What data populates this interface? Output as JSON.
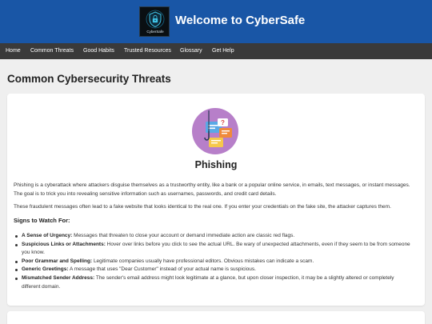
{
  "header": {
    "logo_text": "CyberSafe",
    "title": "Welcome to CyberSafe"
  },
  "nav": {
    "items": [
      "Home",
      "Common Threats",
      "Good Habits",
      "Trusted Resources",
      "Glossary",
      "Get Help"
    ]
  },
  "main": {
    "page_title": "Common Cybersecurity Threats",
    "threat": {
      "title": "Phishing",
      "paragraph1": "Phishing is a cyberattack where attackers disguise themselves as a trustworthy entity, like a bank or a popular online service, in emails, text messages, or instant messages. The goal is to trick you into revealing sensitive information such as usernames, passwords, and credit card details.",
      "paragraph2": "These fraudulent messages often lead to a fake website that looks identical to the real one. If you enter your credentials on the fake site, the attacker captures them.",
      "signs_heading": "Signs to Watch For:",
      "signs": [
        {
          "label": "A Sense of Urgency:",
          "text": " Messages that threaten to close your account or demand immediate action are classic red flags."
        },
        {
          "label": "Suspicious Links or Attachments:",
          "text": " Hover over links before you click to see the actual URL. Be wary of unexpected attachments, even if they seem to be from someone you know."
        },
        {
          "label": "Poor Grammar and Spelling:",
          "text": " Legitimate companies usually have professional editors. Obvious mistakes can indicate a scam."
        },
        {
          "label": "Generic Greetings:",
          "text": " A message that uses \"Dear Customer\" instead of your actual name is suspicious."
        },
        {
          "label": "Mismatched Sender Address:",
          "text": " The sender's email address might look legitimate at a glance, but upon closer inspection, it may be a slightly altered or completely different domain."
        }
      ]
    }
  },
  "colors": {
    "header_bg": "#1956a6",
    "nav_bg": "#3a3a3a",
    "page_bg": "#efefef"
  }
}
